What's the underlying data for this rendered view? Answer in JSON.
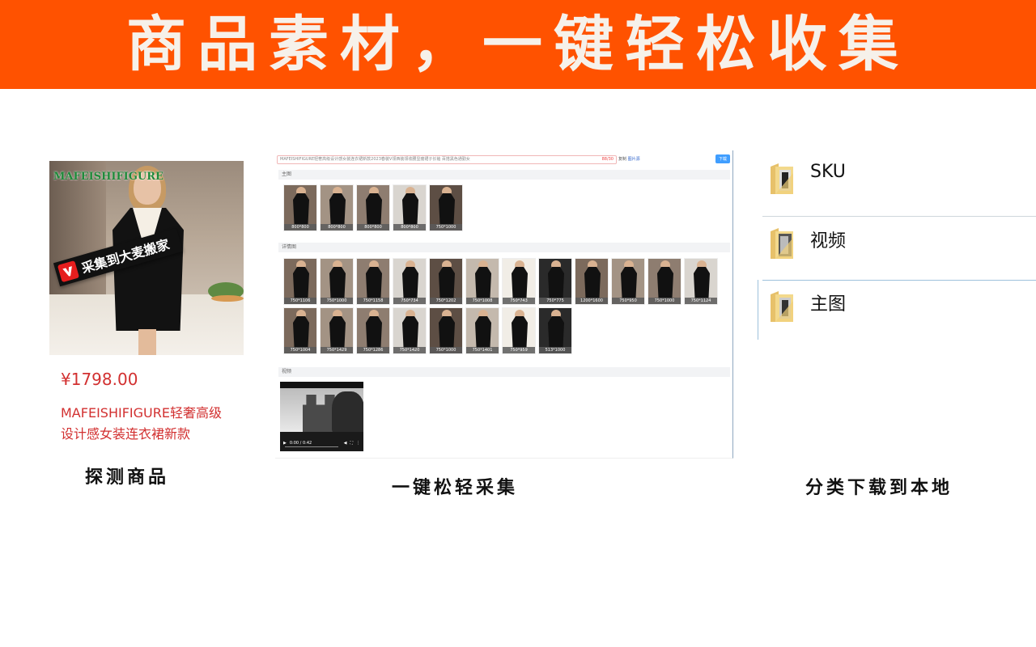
{
  "banner": {
    "title": "商品素材，一键轻松收集",
    "bg_color": "#ff5200"
  },
  "product": {
    "image_brand": "MAFEISHIFIGURE",
    "image_stamp": "采集到大麦搬家",
    "price": "¥1798.00",
    "name": "MAFEISHIFIGURE轻奢高级设计感女装连衣裙新款",
    "price_color": "#d23030"
  },
  "captions": {
    "left": "探测商品",
    "middle": "一键松轻采集",
    "right": "分类下载到本地"
  },
  "panel": {
    "url_text": "MAFEISHIFIGURE轻奢高级设计感女装连衣裙新款2023春装V领西装领收腰显瘦裙子长袖 百搭黑色通勤女",
    "url_count": "88/30",
    "links_prefix": "复制",
    "links_link": "图片源",
    "download_label": "下载",
    "sections": {
      "main": "主图",
      "detail": "详情图",
      "video": "视频"
    },
    "main_thumbs": [
      {
        "label": "800*800"
      },
      {
        "label": "800*800"
      },
      {
        "label": "800*800"
      },
      {
        "label": "800*800"
      },
      {
        "label": "750*1000"
      }
    ],
    "detail_thumbs_row1": [
      {
        "label": "750*1106"
      },
      {
        "label": "750*1000"
      },
      {
        "label": "750*1158"
      },
      {
        "label": "750*734"
      },
      {
        "label": "750*1202"
      },
      {
        "label": "750*1008"
      },
      {
        "label": "750*743"
      },
      {
        "label": "750*775"
      },
      {
        "label": "1200*1600"
      },
      {
        "label": "750*950"
      },
      {
        "label": "750*1000"
      },
      {
        "label": "750*1124"
      }
    ],
    "detail_thumbs_row2": [
      {
        "label": "750*1004"
      },
      {
        "label": "750*1429"
      },
      {
        "label": "750*1286"
      },
      {
        "label": "750*1420"
      },
      {
        "label": "750*1000"
      },
      {
        "label": "750*1401"
      },
      {
        "label": "750*959"
      },
      {
        "label": "513*1000"
      }
    ],
    "video_time": "0:00 / 0:42"
  },
  "folders": [
    {
      "label": "SKU"
    },
    {
      "label": "视频"
    },
    {
      "label": "主图"
    }
  ]
}
